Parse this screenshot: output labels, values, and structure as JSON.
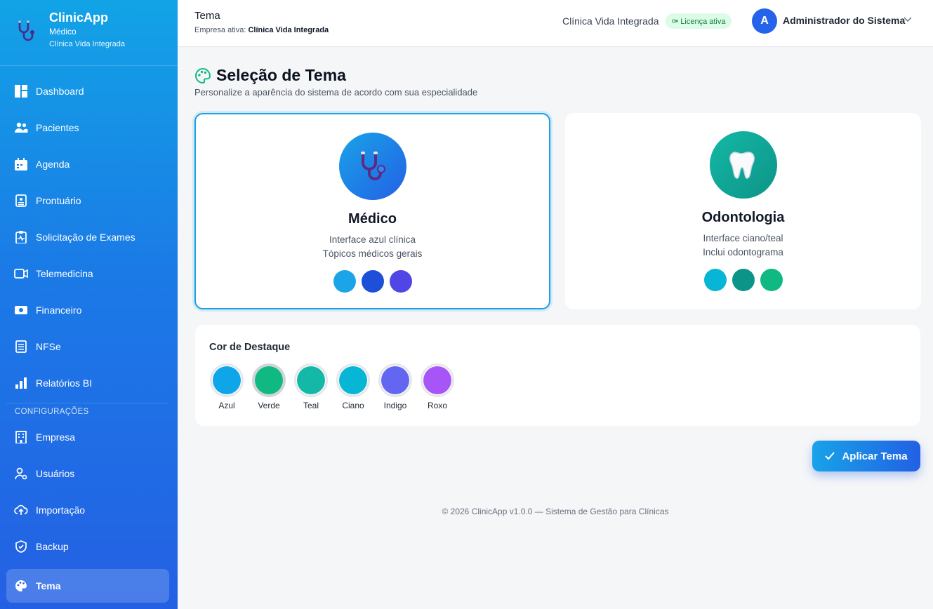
{
  "brand": {
    "name": "ClinicApp",
    "role": "Médico",
    "company": "Clínica Vida Integrada"
  },
  "sidebar": {
    "items": [
      {
        "label": "Dashboard",
        "icon": "dashboard-icon"
      },
      {
        "label": "Pacientes",
        "icon": "users-icon"
      },
      {
        "label": "Agenda",
        "icon": "calendar-icon"
      },
      {
        "label": "Prontuário",
        "icon": "record-icon"
      },
      {
        "label": "Solicitação de Exames",
        "icon": "clipboard-pulse-icon"
      },
      {
        "label": "Telemedicina",
        "icon": "video-icon"
      },
      {
        "label": "Financeiro",
        "icon": "money-icon"
      },
      {
        "label": "NFSe",
        "icon": "invoice-icon"
      },
      {
        "label": "Relatórios BI",
        "icon": "bar-chart-icon"
      }
    ],
    "section_label": "CONFIGURAÇÕES",
    "config_items": [
      {
        "label": "Empresa",
        "icon": "building-icon"
      },
      {
        "label": "Usuários",
        "icon": "user-gear-icon"
      },
      {
        "label": "Importação",
        "icon": "cloud-upload-icon"
      },
      {
        "label": "Backup",
        "icon": "shield-icon"
      },
      {
        "label": "Tema",
        "icon": "palette-icon",
        "active": true
      }
    ]
  },
  "header": {
    "title": "Tema",
    "subtitle_prefix": "Empresa ativa:",
    "subtitle_company": "Clínica Vida Integrada",
    "company": "Clínica Vida Integrada",
    "license_badge": "⚩ Licença ativa",
    "avatar_letter": "A",
    "user_name": "Administrador do Sistema"
  },
  "main": {
    "title": "Seleção de Tema",
    "subtitle": "Personalize a aparência do sistema de acordo com sua especialidade",
    "themes": [
      {
        "name": "Médico",
        "desc_line1": "Interface azul clínica",
        "desc_line2": "Tópicos médicos gerais",
        "selected": true,
        "swatches": [
          "#1ba4e8",
          "#1d4fd8",
          "#4f46e5"
        ]
      },
      {
        "name": "Odontologia",
        "desc_line1": "Interface ciano/teal",
        "desc_line2": "Inclui odontograma",
        "selected": false,
        "swatches": [
          "#06b6d4",
          "#0d9488",
          "#10b981"
        ]
      }
    ],
    "accent": {
      "title": "Cor de Destaque",
      "colors": [
        {
          "label": "Azul",
          "color": "#0ea5e9"
        },
        {
          "label": "Verde",
          "color": "#10b981",
          "active": true
        },
        {
          "label": "Teal",
          "color": "#14b8a6"
        },
        {
          "label": "Ciano",
          "color": "#06b6d4"
        },
        {
          "label": "Indigo",
          "color": "#6366f1"
        },
        {
          "label": "Roxo",
          "color": "#a855f7"
        }
      ]
    },
    "apply_button": "Aplicar Tema"
  },
  "footer": "© 2026 ClinicApp v1.0.0 — Sistema de Gestão para Clínicas"
}
